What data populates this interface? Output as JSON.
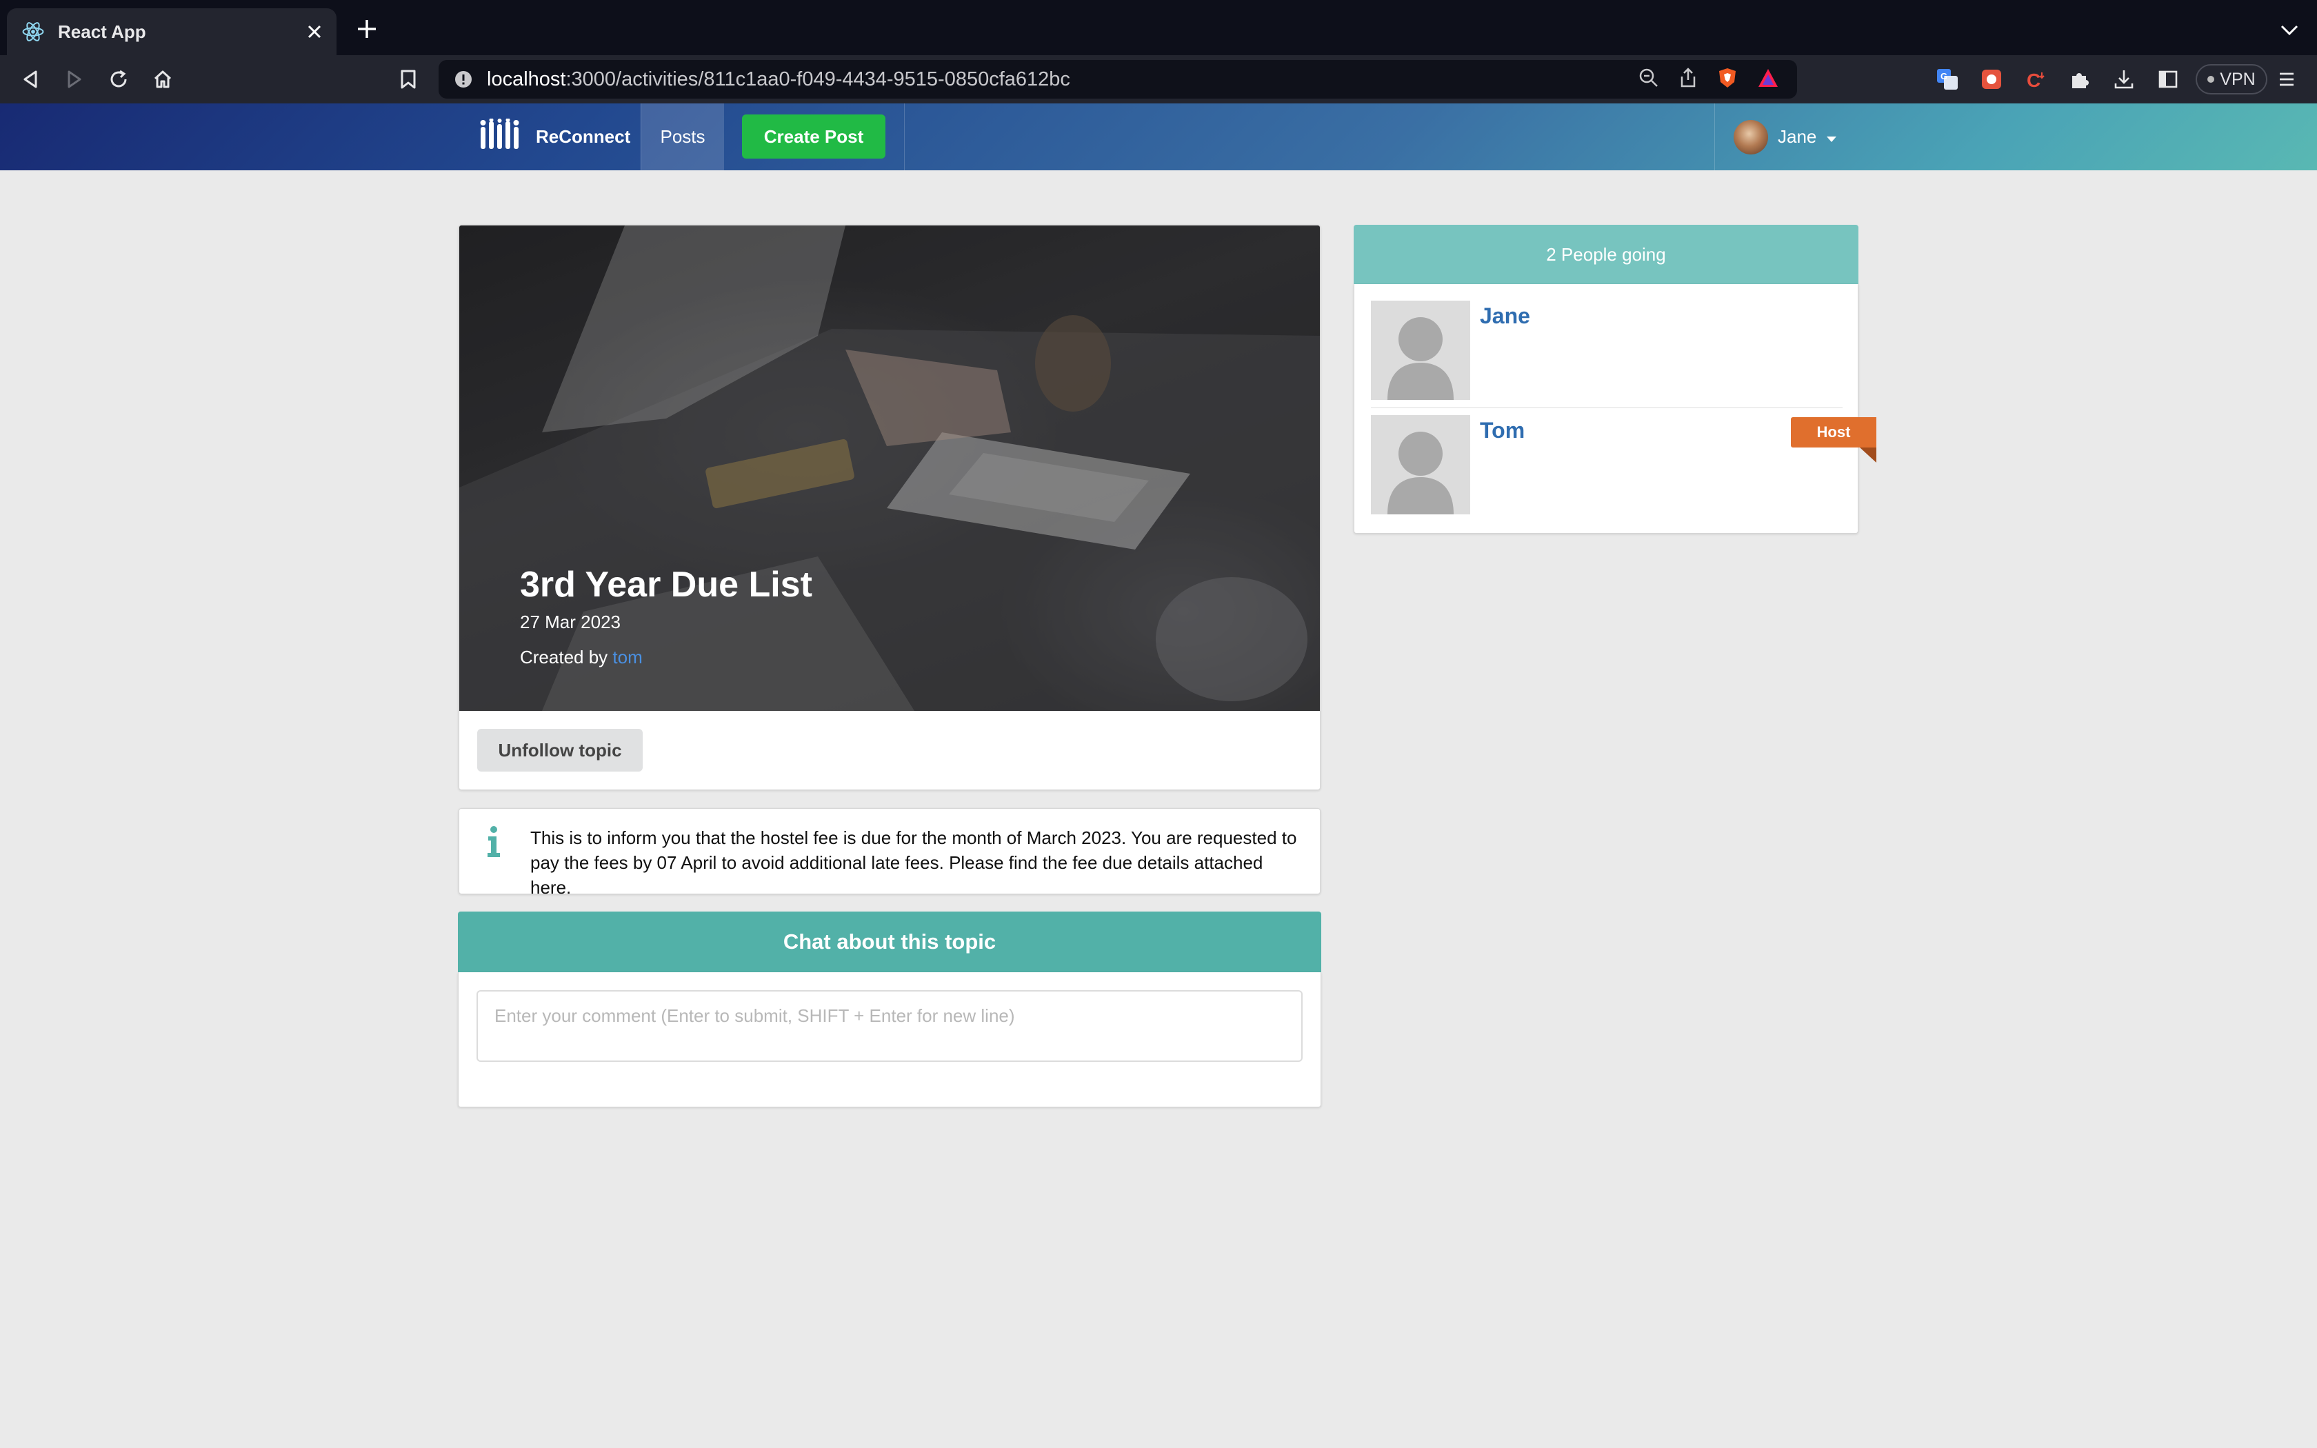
{
  "browser": {
    "tab_title": "React App",
    "url_host": "localhost",
    "url_path": ":3000/activities/811c1aa0-f049-4434-9515-0850cfa612bc",
    "vpn_label": "VPN"
  },
  "nav": {
    "brand": "ReConnect",
    "posts": "Posts",
    "create_post": "Create Post",
    "user_name": "Jane"
  },
  "activity": {
    "title": "3rd Year Due List",
    "date": "27 Mar 2023",
    "created_by_prefix": "Created by ",
    "created_by_user": "tom",
    "unfollow_label": "Unfollow topic",
    "description": "This is to inform you that the hostel fee is due for the month of March 2023. You are requested to pay the fees by 07 April to avoid additional late fees. Please find the fee due details attached here."
  },
  "chat": {
    "header": "Chat about this topic",
    "placeholder": "Enter your comment (Enter to submit, SHIFT + Enter for new line)"
  },
  "attendees": {
    "header": "2 People going",
    "list": [
      {
        "name": "Jane"
      },
      {
        "name": "Tom",
        "badge": "Host"
      }
    ]
  },
  "colors": {
    "nav_gradient_start": "#182a73",
    "nav_gradient_end": "#59b8b3",
    "create_button": "#21ba45",
    "teal_header": "#52b1a8",
    "side_header": "#77c4bf",
    "host_badge": "#e06f2d",
    "link": "#2f6db0"
  }
}
